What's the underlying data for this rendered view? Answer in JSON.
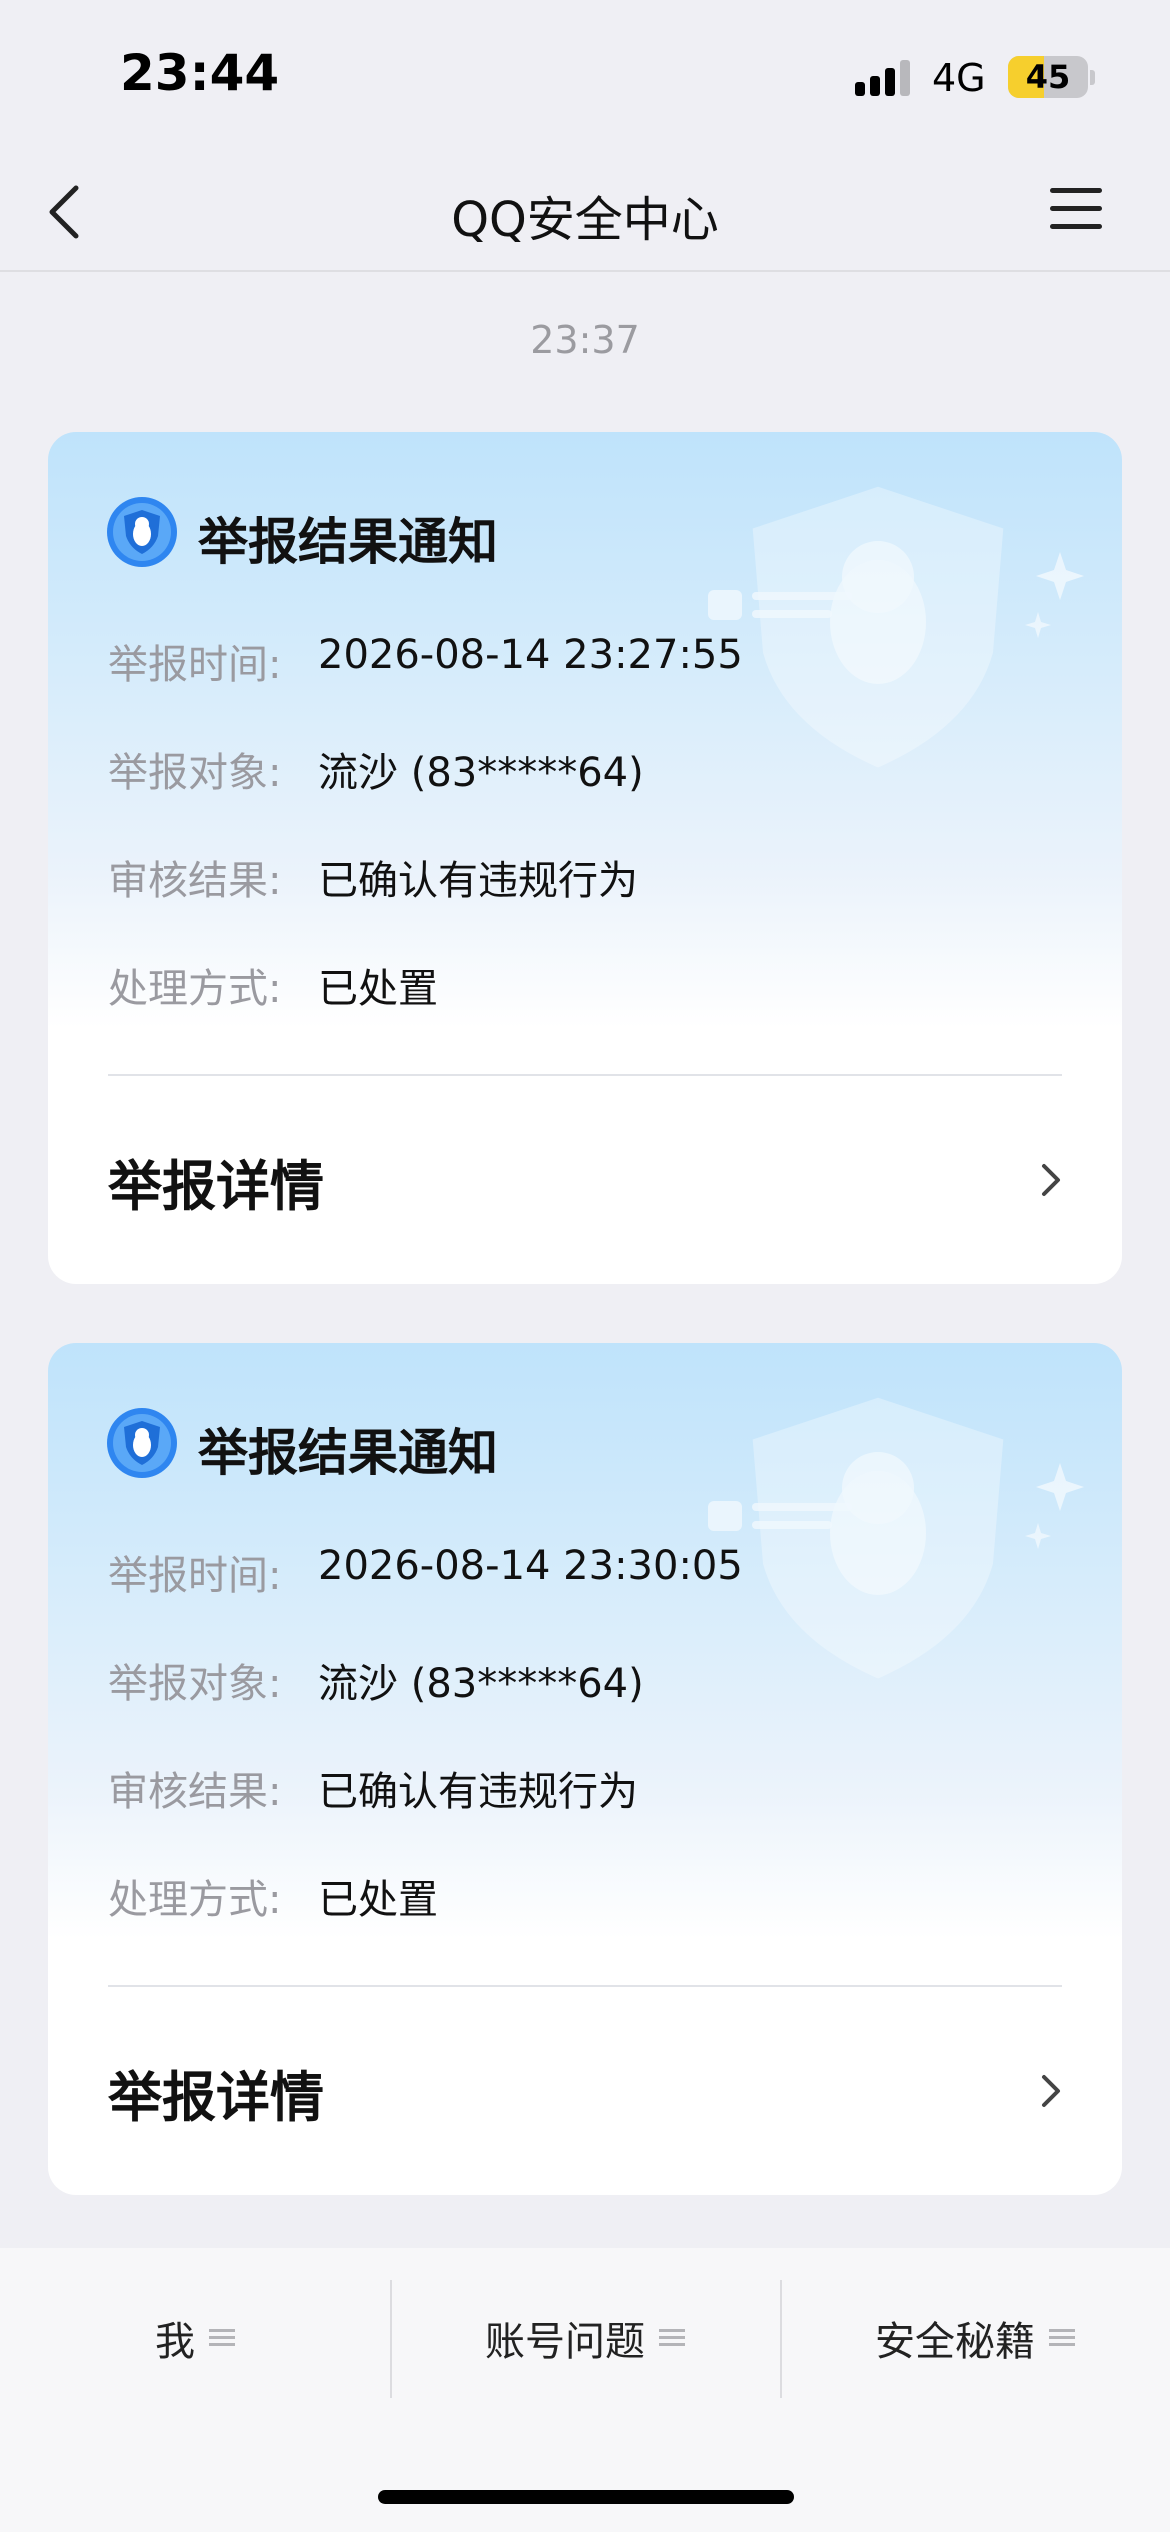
{
  "status_bar": {
    "time": "23:44",
    "network": "4G",
    "battery": "45",
    "battery_fraction": 0.45,
    "signal_bars_active": 3,
    "signal_bars_total": 4
  },
  "nav": {
    "title": "QQ安全中心",
    "back_icon": "chevron-left-icon",
    "menu_icon": "hamburger-menu-icon"
  },
  "message_time": "23:37",
  "cards": [
    {
      "title": "举报结果通知",
      "rows": [
        {
          "label": "举报时间:",
          "value": "2026-08-14 23:27:55"
        },
        {
          "label": "举报对象:",
          "value": "流沙 (83*****64)"
        },
        {
          "label": "审核结果:",
          "value": "已确认有违规行为"
        },
        {
          "label": "处理方式:",
          "value": "已处置"
        }
      ],
      "detail_label": "举报详情"
    },
    {
      "title": "举报结果通知",
      "rows": [
        {
          "label": "举报时间:",
          "value": "2026-08-14 23:30:05"
        },
        {
          "label": "举报对象:",
          "value": "流沙 (83*****64)"
        },
        {
          "label": "审核结果:",
          "value": "已确认有违规行为"
        },
        {
          "label": "处理方式:",
          "value": "已处置"
        }
      ],
      "detail_label": "举报详情"
    }
  ],
  "bottom_tabs": [
    {
      "label": "我"
    },
    {
      "label": "账号问题"
    },
    {
      "label": "安全秘籍"
    }
  ],
  "colors": {
    "page_bg": "#efeff4",
    "card_gradient_top": "#bfe3fb",
    "icon_blue": "#2f86f0",
    "label_gray": "#9a9aa0"
  }
}
